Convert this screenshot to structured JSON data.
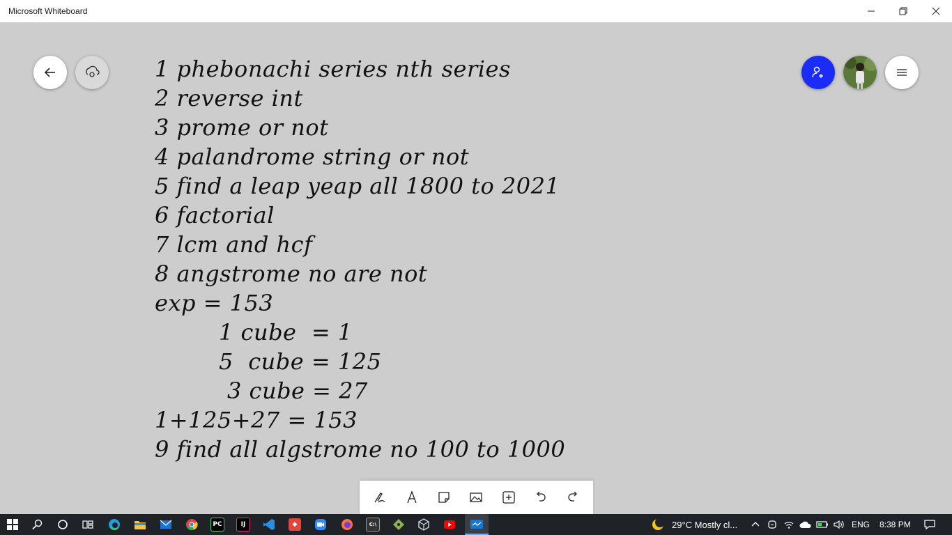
{
  "window": {
    "title": "Microsoft Whiteboard"
  },
  "whiteboard": {
    "lines": [
      "1 phebonachi series nth series",
      "2 reverse int",
      "3 prome or not",
      "4 palandrome string or not",
      "5 find a leap yeap all 1800 to 2021",
      "6 factorial",
      "7 lcm and hcf",
      "8 angstrome no are not",
      "exp = 153",
      "1 cube  = 1",
      "5  cube = 125",
      "3 cube = 27",
      "1+125+27 = 153",
      "9 find all algstrome no 100 to 1000"
    ]
  },
  "taskbar": {
    "weather": "29°C  Mostly cl...",
    "language": "ENG",
    "time": "8:38 PM"
  },
  "colors": {
    "accent": "#1a2cf5",
    "canvas": "#cdcdcd",
    "taskbar": "#1f2328"
  }
}
